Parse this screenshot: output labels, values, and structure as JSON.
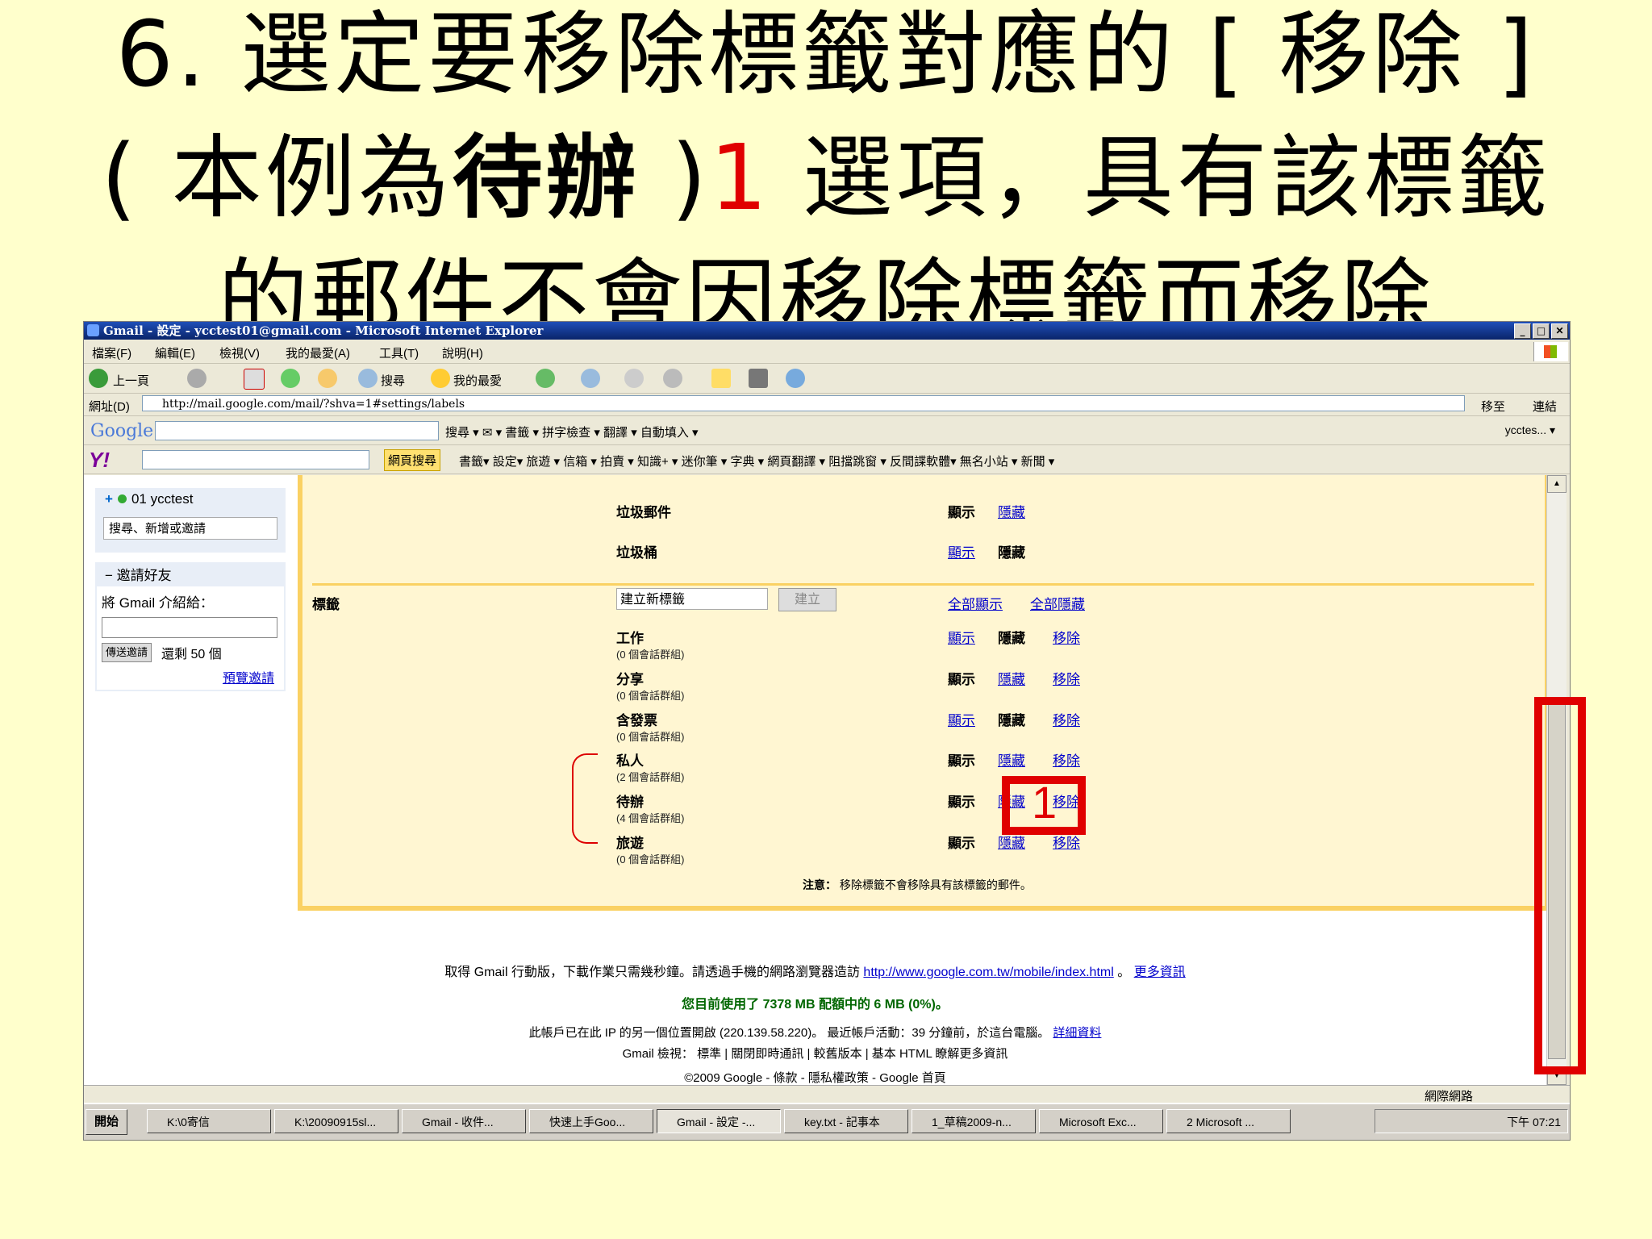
{
  "slide": {
    "line1": "6. 選定要移除標籤對應的 [ 移除 ]",
    "line2_a": "( 本例為",
    "line2_b": "待辦",
    "line2_c": " )",
    "line2_num": "1",
    "line2_d": " 選項，具有該標籤",
    "line3": "的郵件不會因移除標籤而移除"
  },
  "window": {
    "title": "Gmail - 設定 - ycctest01@gmail.com - Microsoft Internet Explorer",
    "menus": [
      "檔案(F)",
      "編輯(E)",
      "檢視(V)",
      "我的最愛(A)",
      "工具(T)",
      "說明(H)"
    ],
    "toolbar": {
      "back": "上一頁",
      "search": "搜尋",
      "favorites": "我的最愛"
    },
    "address_label": "網址(D)",
    "url": "http://mail.google.com/mail/?shva=1#settings/labels",
    "go": "移至",
    "links": "連結",
    "google_logo": "Google",
    "google_items": "搜尋 ▾  ✉ ▾  書籤 ▾  拼字檢查 ▾  翻譯 ▾  自動填入 ▾",
    "google_right": "ycctes... ▾",
    "yahoo_logo": "Y!",
    "yahoo_search": "網頁搜尋",
    "yahoo_items": "書籤▾  設定▾  旅遊 ▾  信箱 ▾  拍賣 ▾  知識+ ▾  迷你筆 ▾  字典 ▾  網頁翻譯 ▾  阻擋跳窗 ▾  反間諜軟體▾  無名小站 ▾  新聞 ▾"
  },
  "sidebar": {
    "user": "01 ycctest",
    "search_placeholder": "搜尋、新增或邀請",
    "invite_header": "邀請好友",
    "invite_intro": "將 Gmail 介紹給：",
    "send_button": "傳送邀請",
    "remaining": "還剩 50 個",
    "preview": "預覽邀請"
  },
  "settings": {
    "spam": "垃圾郵件",
    "trash": "垃圾桶",
    "show": "顯示",
    "hide": "隱藏",
    "labels_header": "標籤",
    "new_label_placeholder": "建立新標籤",
    "create": "建立",
    "show_all": "全部顯示",
    "hide_all": "全部隱藏",
    "remove": "移除",
    "labels": [
      {
        "name": "工作",
        "count": "(0 個會話群組)"
      },
      {
        "name": "分享",
        "count": "(0 個會話群組)"
      },
      {
        "name": "含發票",
        "count": "(0 個會話群組)"
      },
      {
        "name": "私人",
        "count": "(2 個會話群組)"
      },
      {
        "name": "待辦",
        "count": "(4 個會話群組)"
      },
      {
        "name": "旅遊",
        "count": "(0 個會話群組)"
      }
    ],
    "note_bold": "注意：",
    "note": "移除標籤不會移除具有該標籤的郵件。"
  },
  "footer": {
    "mobile": "取得 Gmail 行動版，下載作業只需幾秒鐘。請透過手機的網路瀏覽器造訪",
    "mobile_url": "http://www.google.com.tw/mobile/index.html",
    "more_info": "更多資訊",
    "quota": "您目前使用了 7378 MB 配額中的 6 MB (0%)。",
    "ip": "此帳戶已在此 IP 的另一個位置開啟 (220.139.58.220)。   最近帳戶活動：39 分鐘前，於這台電腦。",
    "details": "詳細資料",
    "views": "Gmail 檢視： 標準 | 關閉即時通訊 | 較舊版本 | 基本 HTML  瞭解更多資訊",
    "copyright": "©2009 Google - 條款 - 隱私權政策 - Google 首頁"
  },
  "statusbar": {
    "zone": "網際網路"
  },
  "taskbar": {
    "start": "開始",
    "tasks": [
      "K:\\0寄信",
      "K:\\20090915sl...",
      "Gmail - 收件...",
      "快速上手Goo...",
      "Gmail - 設定 -...",
      "key.txt - 記事本",
      "1_草稿2009-n...",
      "Microsoft Exc...",
      "2 Microsoft ..."
    ],
    "clock": "下午 07:21"
  },
  "annotation": {
    "step": "1"
  },
  "colors": {
    "slide_bg": "#ffffcc",
    "highlight": "#e00000",
    "panel_border": "#fad163",
    "link": "#0000cc"
  }
}
